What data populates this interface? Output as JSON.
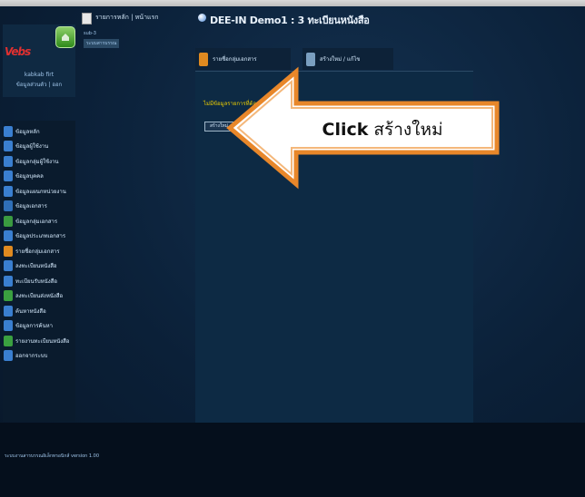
{
  "topbar": {
    "text1": ""
  },
  "sidebar": {
    "logo_text": "Vebs",
    "user_name": "kabkab firt",
    "user_links": "ข้อมูลส่วนตัว | ออก",
    "menu": [
      {
        "label": "ข้อมูลหลัก",
        "color": "#3a7fd0"
      },
      {
        "label": "ข้อมูลผู้ใช้งาน",
        "color": "#3a7fd0"
      },
      {
        "label": "ข้อมูลกลุ่มผู้ใช้งาน",
        "color": "#3a7fd0"
      },
      {
        "label": "ข้อมูลบุคคล",
        "color": "#3a7fd0"
      },
      {
        "label": "ข้อมูลแผนกหน่วยงาน",
        "color": "#3a7fd0"
      },
      {
        "label": "ข้อมูลเอกสาร",
        "color": "#2f6fb8"
      },
      {
        "label": "ข้อมูลกลุ่มเอกสาร",
        "color": "#3a9a40"
      },
      {
        "label": "ข้อมูลประเภทเอกสาร",
        "color": "#3a7fd0"
      },
      {
        "label": "รายชื่อกลุ่มเอกสาร",
        "color": "#e08a20"
      },
      {
        "label": "ลงทะเบียนหนังสือ",
        "color": "#3a7fd0"
      },
      {
        "label": "ทะเบียนรับหนังสือ",
        "color": "#3a7fd0"
      },
      {
        "label": "ลงทะเบียนส่งหนังสือ",
        "color": "#3aa040"
      },
      {
        "label": "ค้นหาหนังสือ",
        "color": "#3a7fd0"
      },
      {
        "label": "ข้อมูลการค้นหา",
        "color": "#3a7fd0"
      },
      {
        "label": "รายงานทะเบียนหนังสือ",
        "color": "#3aa040"
      },
      {
        "label": "ออกจากระบบ",
        "color": "#3a7fd0"
      }
    ]
  },
  "header": {
    "breadcrumb": "รายการหลัก | หน้าแรก",
    "sub_label": "sub-3",
    "sub_value": "ระบบสารบรรณ",
    "title": "DEE-IN Demo1 : 3 ทะเบียนหนังสือ"
  },
  "tabs": [
    {
      "label": "รายชื่อกลุ่มเอกสาร",
      "icon_color": "#e08a20"
    },
    {
      "label": "สร้างใหม่ / แก้ไข",
      "icon_color": "#7a9fc0"
    }
  ],
  "panel": {
    "heading": "ไม่มีข้อมูลรายการที่ต้องการ",
    "create_button": "สร้างใหม่"
  },
  "footer": {
    "text": "ระบบงานสารบรรณอิเล็กทรอนิกส์ version 1.00"
  },
  "callout": {
    "bold": "Click",
    "text": " สร้างใหม่",
    "fill": "#ffffff",
    "stroke": "#e8872a"
  }
}
